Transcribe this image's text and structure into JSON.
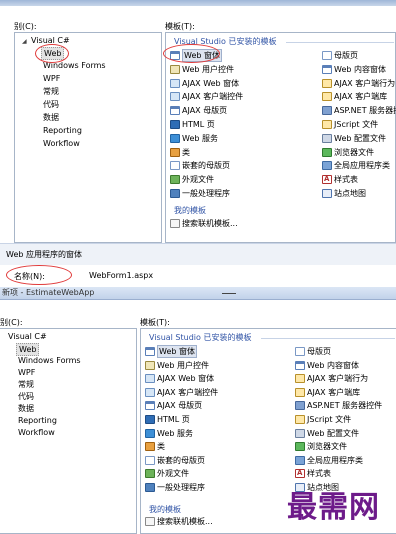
{
  "dialog1": {
    "categories_label": "别(C):",
    "templates_label": "模板(T):",
    "tree": {
      "root": "Visual C#",
      "children": [
        "Web",
        "Windows Forms",
        "WPF",
        "常规",
        "代码",
        "数据",
        "Reporting",
        "Workflow"
      ],
      "selected": "Web"
    },
    "group_header": "Visual Studio 已安装的模板",
    "templates_left": [
      {
        "label": "Web 窗体",
        "icon": "web-form-icon"
      },
      {
        "label": "Web 用户控件",
        "icon": "user-control-icon"
      },
      {
        "label": "AJAX Web 窗体",
        "icon": "ajax-form-icon"
      },
      {
        "label": "AJAX 客户端控件",
        "icon": "ajax-control-icon"
      },
      {
        "label": "AJAX 母版页",
        "icon": "ajax-master-icon"
      },
      {
        "label": "HTML 页",
        "icon": "html-page-icon"
      },
      {
        "label": "Web 服务",
        "icon": "web-service-icon"
      },
      {
        "label": "类",
        "icon": "class-icon"
      },
      {
        "label": "嵌套的母版页",
        "icon": "nested-master-icon"
      },
      {
        "label": "外观文件",
        "icon": "skin-file-icon"
      },
      {
        "label": "一般处理程序",
        "icon": "handler-icon"
      }
    ],
    "templates_right": [
      {
        "label": "母版页",
        "icon": "master-page-icon"
      },
      {
        "label": "Web 内容窗体",
        "icon": "content-form-icon"
      },
      {
        "label": "AJAX 客户端行为",
        "icon": "ajax-behavior-icon"
      },
      {
        "label": "AJAX 客户端库",
        "icon": "ajax-library-icon"
      },
      {
        "label": "ASP.NET 服务器控",
        "icon": "server-control-icon"
      },
      {
        "label": "JScript 文件",
        "icon": "jscript-icon"
      },
      {
        "label": "Web 配置文件",
        "icon": "web-config-icon"
      },
      {
        "label": "浏览器文件",
        "icon": "browser-file-icon"
      },
      {
        "label": "全局应用程序类",
        "icon": "global-class-icon"
      },
      {
        "label": "样式表",
        "icon": "stylesheet-icon"
      },
      {
        "label": "站点地图",
        "icon": "sitemap-icon"
      }
    ],
    "my_templates": "我的模板",
    "search_online": "搜索联机模板...",
    "description": "Web 应用程序的窗体",
    "name_label": "名称(N):",
    "name_value": "WebForm1.aspx"
  },
  "dialog2": {
    "title": "新项 - EstimateWebApp",
    "categories_label": "别(C):",
    "templates_label": "模板(T):",
    "tree": {
      "root": "Visual C#",
      "children": [
        "Web",
        "Windows Forms",
        "WPF",
        "常规",
        "代码",
        "数据",
        "Reporting",
        "Workflow"
      ],
      "selected": "Web"
    },
    "group_header": "Visual Studio 已安装的模板",
    "templates_left": [
      {
        "label": "Web 窗体",
        "icon": "web-form-icon"
      },
      {
        "label": "Web 用户控件",
        "icon": "user-control-icon"
      },
      {
        "label": "AJAX Web 窗体",
        "icon": "ajax-form-icon"
      },
      {
        "label": "AJAX 客户端控件",
        "icon": "ajax-control-icon"
      },
      {
        "label": "AJAX 母版页",
        "icon": "ajax-master-icon"
      },
      {
        "label": "HTML 页",
        "icon": "html-page-icon"
      },
      {
        "label": "Web 服务",
        "icon": "web-service-icon"
      },
      {
        "label": "类",
        "icon": "class-icon"
      },
      {
        "label": "嵌套的母版页",
        "icon": "nested-master-icon"
      },
      {
        "label": "外观文件",
        "icon": "skin-file-icon"
      },
      {
        "label": "一般处理程序",
        "icon": "handler-icon"
      }
    ],
    "templates_right": [
      {
        "label": "母版页",
        "icon": "master-page-icon"
      },
      {
        "label": "Web 内容窗体",
        "icon": "content-form-icon"
      },
      {
        "label": "AJAX 客户端行为",
        "icon": "ajax-behavior-icon"
      },
      {
        "label": "AJAX 客户端库",
        "icon": "ajax-library-icon"
      },
      {
        "label": "ASP.NET 服务器控件",
        "icon": "server-control-icon"
      },
      {
        "label": "JScript 文件",
        "icon": "jscript-icon"
      },
      {
        "label": "Web 配置文件",
        "icon": "web-config-icon"
      },
      {
        "label": "浏览器文件",
        "icon": "browser-file-icon"
      },
      {
        "label": "全局应用程序类",
        "icon": "global-class-icon"
      },
      {
        "label": "样式表",
        "icon": "stylesheet-icon"
      },
      {
        "label": "站点地图",
        "icon": "sitemap-icon"
      }
    ],
    "my_templates": "我的模板",
    "search_online": "搜索联机模板..."
  },
  "watermark": "最需网",
  "colors": {
    "accent": "#3154a6",
    "highlight_circle": "#e03a3a",
    "watermark": "#6d1b8a"
  }
}
